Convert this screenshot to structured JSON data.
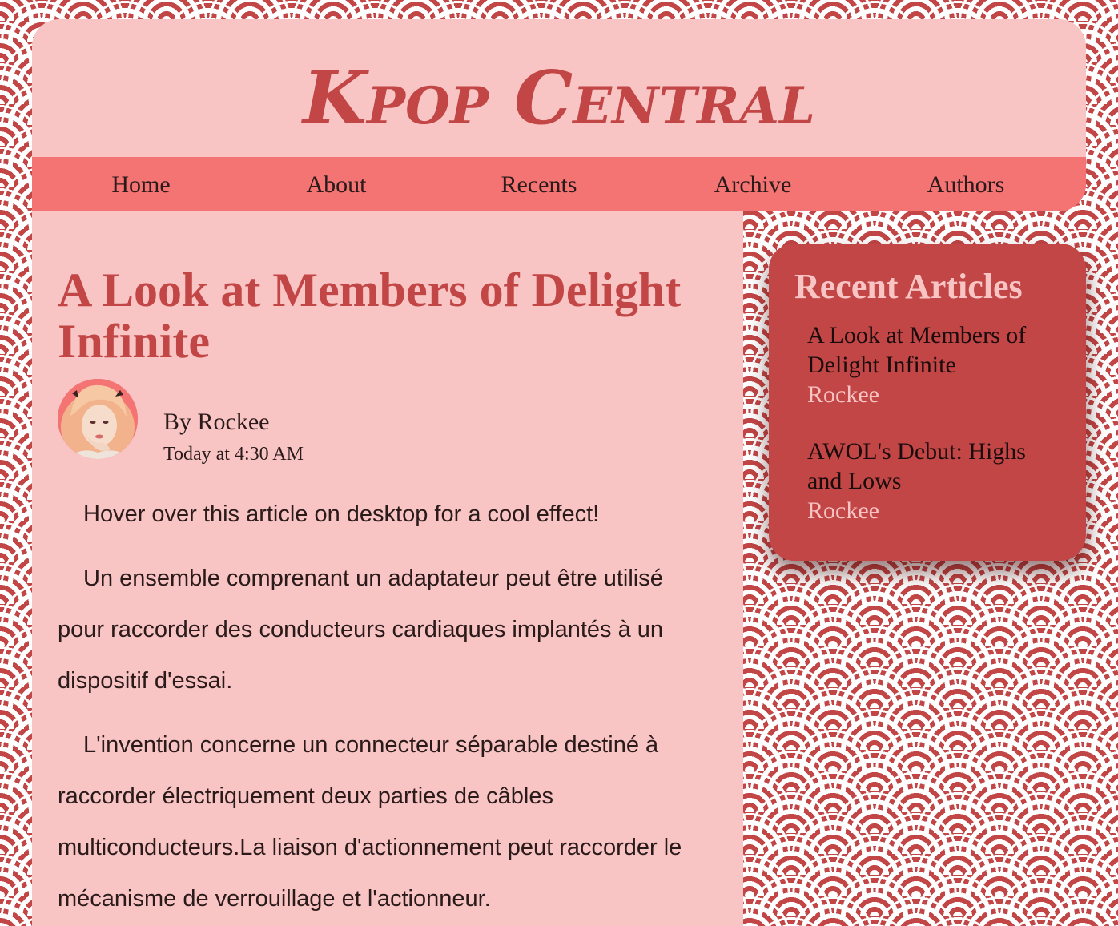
{
  "site": {
    "title": "Kpop Central"
  },
  "nav": {
    "items": [
      {
        "label": "Home"
      },
      {
        "label": "About"
      },
      {
        "label": "Recents"
      },
      {
        "label": "Archive"
      },
      {
        "label": "Authors"
      }
    ]
  },
  "article": {
    "title": "A Look at Members of Delight Infinite",
    "byline": "By Rockee",
    "timestamp": "Today at 4:30 AM",
    "paragraphs": [
      "Hover over this article on desktop for a cool effect!",
      "Un ensemble comprenant un adaptateur peut être utilisé pour raccorder des conducteurs cardiaques implantés à un dispositif d'essai.",
      "L'invention concerne un connecteur séparable destiné à raccorder électriquement deux parties de câbles multiconducteurs.La liaison d'actionnement peut raccorder le mécanisme de verrouillage et l'actionneur."
    ]
  },
  "sidebar": {
    "title": "Recent Articles",
    "items": [
      {
        "title": "A Look at Members of Delight Infinite",
        "author": "Rockee"
      },
      {
        "title": "AWOL's Debut: Highs and Lows",
        "author": "Rockee"
      }
    ]
  },
  "colors": {
    "background": "#c24646",
    "panel": "#f8c4c4",
    "nav": "#f47373",
    "accent": "#c24646",
    "text": "#2a1a1a"
  }
}
